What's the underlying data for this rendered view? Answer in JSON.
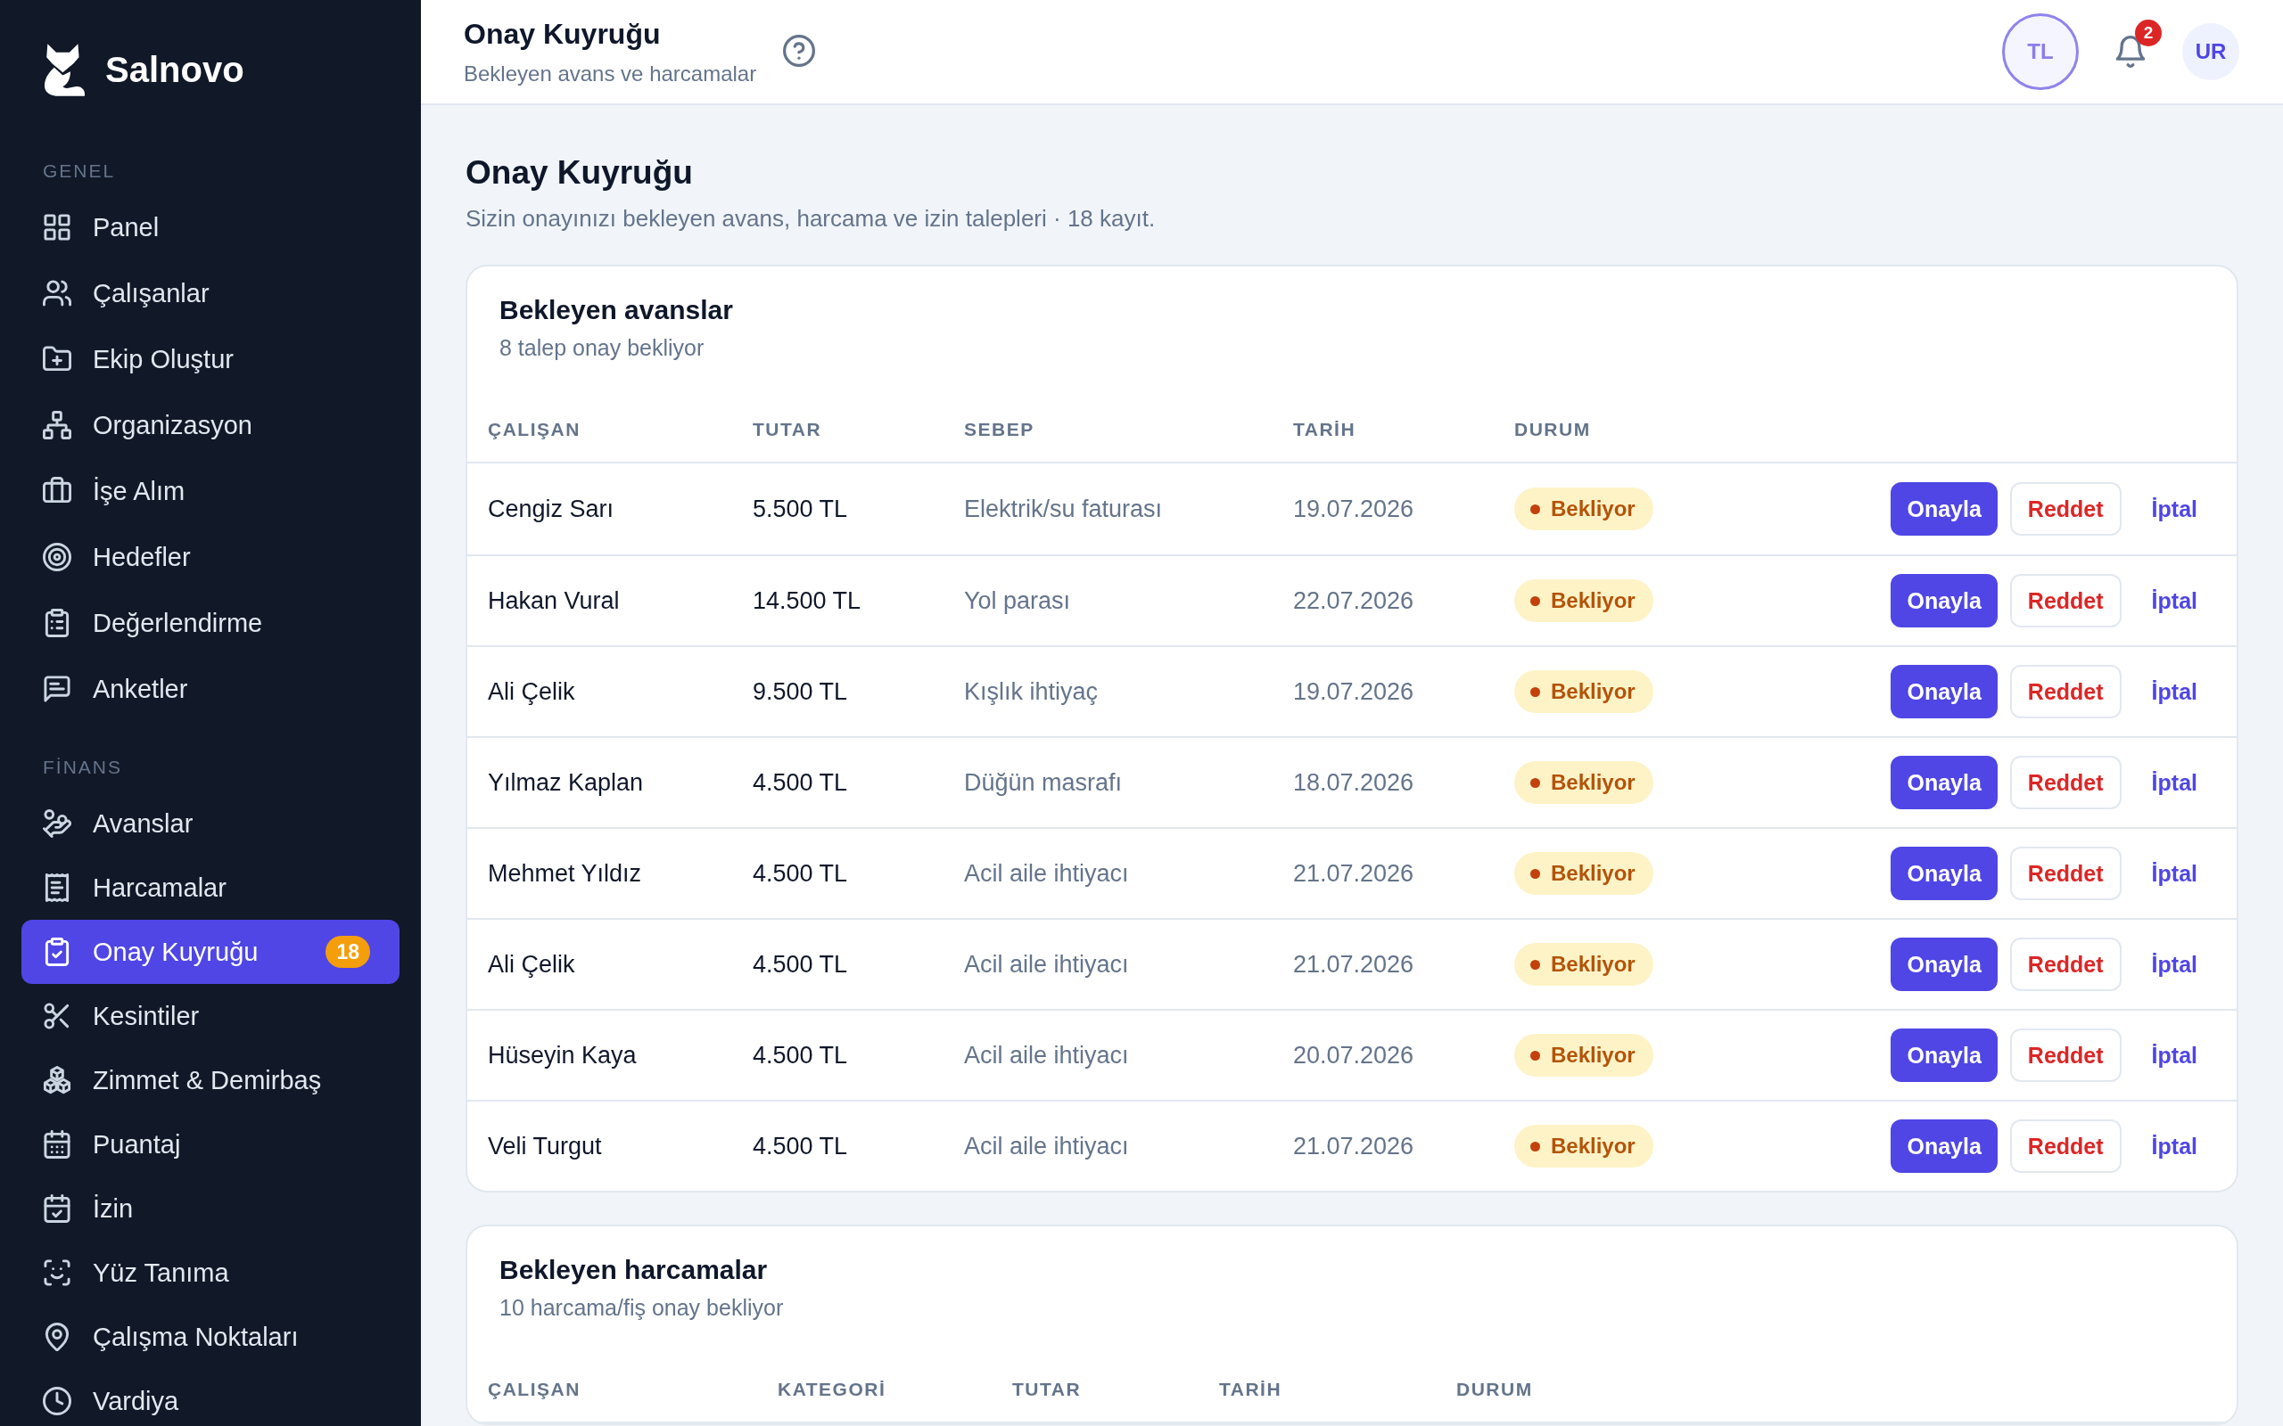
{
  "sidebar": {
    "brand": "Salnovo",
    "sections": [
      {
        "label": "GENEL",
        "items": [
          {
            "label": "Panel",
            "selected": false
          },
          {
            "label": "Çalışanlar",
            "selected": false
          },
          {
            "label": "Ekip Oluştur",
            "selected": false
          },
          {
            "label": "Organizasyon",
            "selected": false
          },
          {
            "label": "İşe Alım",
            "selected": false
          },
          {
            "label": "Hedefler",
            "selected": false
          },
          {
            "label": "Değerlendirme",
            "selected": false
          },
          {
            "label": "Anketler",
            "selected": false
          }
        ]
      },
      {
        "label": "FİNANS",
        "items": [
          {
            "label": "Avanslar",
            "selected": false
          },
          {
            "label": "Harcamalar",
            "selected": false
          },
          {
            "label": "Onay Kuyruğu",
            "selected": true,
            "badge": "18"
          },
          {
            "label": "Kesintiler",
            "selected": false
          },
          {
            "label": "Zimmet & Demirbaş",
            "selected": false
          },
          {
            "label": "Puantaj",
            "selected": false
          },
          {
            "label": "İzin",
            "selected": false
          },
          {
            "label": "Yüz Tanıma",
            "selected": false
          },
          {
            "label": "Çalışma Noktaları",
            "selected": false
          },
          {
            "label": "Vardiya",
            "selected": false
          }
        ]
      }
    ]
  },
  "header": {
    "title": "Onay Kuyruğu",
    "subtitle": "Bekleyen avans ve harcamalar",
    "initials_button": "TL",
    "notification_count": "2",
    "user_initials": "UR"
  },
  "page": {
    "title": "Onay Kuyruğu",
    "subtitle": "Sizin onayınızı bekleyen avans, harcama ve izin talepleri · 18 kayıt."
  },
  "advances": {
    "title": "Bekleyen avanslar",
    "subtitle": "8 talep onay bekliyor",
    "columns": [
      "ÇALIŞAN",
      "TUTAR",
      "SEBEP",
      "TARİH",
      "DURUM"
    ],
    "rows": [
      {
        "employee": "Cengiz Sarı",
        "amount": "5.500 TL",
        "reason": "Elektrik/su faturası",
        "date": "19.07.2026",
        "status": "Bekliyor",
        "actions": [
          {
            "label": "Onayla",
            "kind": "primary"
          },
          {
            "label": "Reddet",
            "kind": "danger"
          },
          {
            "label": "İptal",
            "kind": "link"
          }
        ]
      },
      {
        "employee": "Hakan Vural",
        "amount": "14.500 TL",
        "reason": "Yol parası",
        "date": "22.07.2026",
        "status": "Bekliyor",
        "actions": [
          {
            "label": "Onayla",
            "kind": "primary"
          },
          {
            "label": "Reddet",
            "kind": "danger"
          },
          {
            "label": "İptal",
            "kind": "link"
          }
        ]
      },
      {
        "employee": "Ali Çelik",
        "amount": "9.500 TL",
        "reason": "Kışlık ihtiyaç",
        "date": "19.07.2026",
        "status": "Bekliyor",
        "actions": [
          {
            "label": "Onayla",
            "kind": "primary"
          },
          {
            "label": "Reddet",
            "kind": "danger"
          },
          {
            "label": "İptal",
            "kind": "link"
          }
        ]
      },
      {
        "employee": "Yılmaz Kaplan",
        "amount": "4.500 TL",
        "reason": "Düğün masrafı",
        "date": "18.07.2026",
        "status": "Bekliyor",
        "actions": [
          {
            "label": "Onayla",
            "kind": "primary"
          },
          {
            "label": "Reddet",
            "kind": "danger"
          },
          {
            "label": "İptal",
            "kind": "link"
          }
        ]
      },
      {
        "employee": "Mehmet Yıldız",
        "amount": "4.500 TL",
        "reason": "Acil aile ihtiyacı",
        "date": "21.07.2026",
        "status": "Bekliyor",
        "actions": [
          {
            "label": "Onayla",
            "kind": "primary"
          },
          {
            "label": "Reddet",
            "kind": "danger"
          },
          {
            "label": "İptal",
            "kind": "link"
          }
        ]
      },
      {
        "employee": "Ali Çelik",
        "amount": "4.500 TL",
        "reason": "Acil aile ihtiyacı",
        "date": "21.07.2026",
        "status": "Bekliyor",
        "actions": [
          {
            "label": "Onayla",
            "kind": "primary"
          },
          {
            "label": "Reddet",
            "kind": "danger"
          },
          {
            "label": "İptal",
            "kind": "link"
          }
        ]
      },
      {
        "employee": "Hüseyin Kaya",
        "amount": "4.500 TL",
        "reason": "Acil aile ihtiyacı",
        "date": "20.07.2026",
        "status": "Bekliyor",
        "actions": [
          {
            "label": "Onayla",
            "kind": "primary"
          },
          {
            "label": "Reddet",
            "kind": "danger"
          },
          {
            "label": "İptal",
            "kind": "link"
          }
        ]
      },
      {
        "employee": "Veli Turgut",
        "amount": "4.500 TL",
        "reason": "Acil aile ihtiyacı",
        "date": "21.07.2026",
        "status": "Bekliyor",
        "actions": [
          {
            "label": "Onayla",
            "kind": "primary"
          },
          {
            "label": "Reddet",
            "kind": "danger"
          },
          {
            "label": "İptal",
            "kind": "link"
          }
        ]
      }
    ]
  },
  "expenses": {
    "title": "Bekleyen harcamalar",
    "subtitle": "10 harcama/fiş onay bekliyor",
    "columns": [
      "ÇALIŞAN",
      "KATEGORİ",
      "TUTAR",
      "TARİH",
      "DURUM"
    ]
  }
}
